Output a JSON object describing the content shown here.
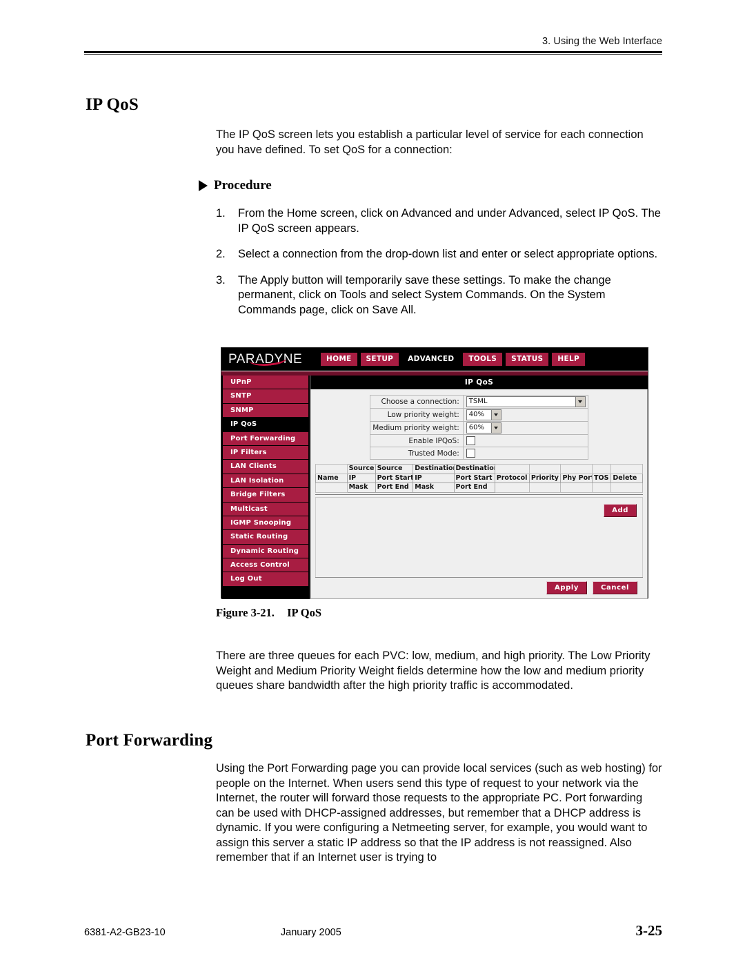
{
  "header": {
    "running_head": "3. Using the Web Interface"
  },
  "sections": {
    "ip_qos": {
      "heading": "IP QoS",
      "intro": "The IP QoS screen lets you establish a particular level of service for each connection you have defined. To set QoS for a connection:",
      "procedure_label": "Procedure",
      "steps": [
        {
          "num": "1.",
          "text": "From the Home screen, click on Advanced and under Advanced, select IP QoS. The IP QoS screen appears."
        },
        {
          "num": "2.",
          "text": "Select a connection from the drop-down list and enter or select appropriate options."
        },
        {
          "num": "3.",
          "text": "The Apply button will temporarily save these settings. To make the change permanent, click on Tools and select System Commands. On the System Commands page, click on Save All."
        }
      ],
      "figure_caption_label": "Figure 3-21.",
      "figure_caption_title": "IP QoS",
      "post_figure": "There are three queues for each PVC: low, medium, and high priority. The Low Priority Weight and Medium Priority Weight fields determine how the low and medium priority queues share bandwidth after the high priority traffic is accommodated."
    },
    "port_forwarding": {
      "heading": "Port Forwarding",
      "body": "Using the Port Forwarding page you can provide local services (such as web hosting) for people on the Internet. When users send this type of request to your network via the Internet, the router will forward those requests to the appropriate PC. Port forwarding can be used with DHCP-assigned addresses, but remember that a DHCP address is dynamic. If you were configuring a Netmeeting server, for example, you would want to assign this server a static IP address so that the IP address is not reassigned. Also remember that if an Internet user is trying to"
    }
  },
  "figure": {
    "brand": "PARADYNE",
    "colors": {
      "maroon": "#a81d42",
      "dark_maroon": "#6e0f2a",
      "black": "#000000",
      "panel": "#efefef"
    },
    "nav_tabs": [
      {
        "label": "HOME",
        "active": false
      },
      {
        "label": "SETUP",
        "active": false
      },
      {
        "label": "ADVANCED",
        "active": true
      },
      {
        "label": "TOOLS",
        "active": false
      },
      {
        "label": "STATUS",
        "active": false
      },
      {
        "label": "HELP",
        "active": false
      }
    ],
    "sidebar_items": [
      {
        "label": "UPnP",
        "active": false
      },
      {
        "label": "SNTP",
        "active": false
      },
      {
        "label": "SNMP",
        "active": false
      },
      {
        "label": "IP QoS",
        "active": true
      },
      {
        "label": "Port Forwarding",
        "active": false
      },
      {
        "label": "IP Filters",
        "active": false
      },
      {
        "label": "LAN Clients",
        "active": false
      },
      {
        "label": "LAN Isolation",
        "active": false
      },
      {
        "label": "Bridge Filters",
        "active": false
      },
      {
        "label": "Multicast",
        "active": false
      },
      {
        "label": "IGMP Snooping",
        "active": false
      },
      {
        "label": "Static Routing",
        "active": false
      },
      {
        "label": "Dynamic Routing",
        "active": false
      },
      {
        "label": "Access Control",
        "active": false
      },
      {
        "label": "Log Out",
        "active": false
      }
    ],
    "panel_title": "IP QoS",
    "form": {
      "connection_label": "Choose a connection:",
      "connection_value": "TSML",
      "low_weight_label": "Low priority weight:",
      "low_weight_value": "40%",
      "medium_weight_label": "Medium priority weight:",
      "medium_weight_value": "60%",
      "enable_label": "Enable IPQoS:",
      "enable_checked": false,
      "trusted_label": "Trusted Mode:",
      "trusted_checked": false
    },
    "rules_table": {
      "header_rows": [
        [
          "",
          "Source",
          "Source",
          "Destination",
          "Destination",
          "",
          "",
          "",
          "",
          ""
        ],
        [
          "Name",
          "IP",
          "Port Start",
          "IP",
          "Port Start",
          "Protocol",
          "Priority",
          "Phy Port",
          "TOS",
          "Delete"
        ],
        [
          "",
          "Mask",
          "Port End",
          "Mask",
          "Port End",
          "",
          "",
          "",
          "",
          ""
        ]
      ],
      "rows": []
    },
    "buttons": {
      "add": "Add",
      "apply": "Apply",
      "cancel": "Cancel"
    }
  },
  "footer": {
    "doc_number": "6381-A2-GB23-10",
    "date": "January 2005",
    "page_number": "3-25"
  }
}
